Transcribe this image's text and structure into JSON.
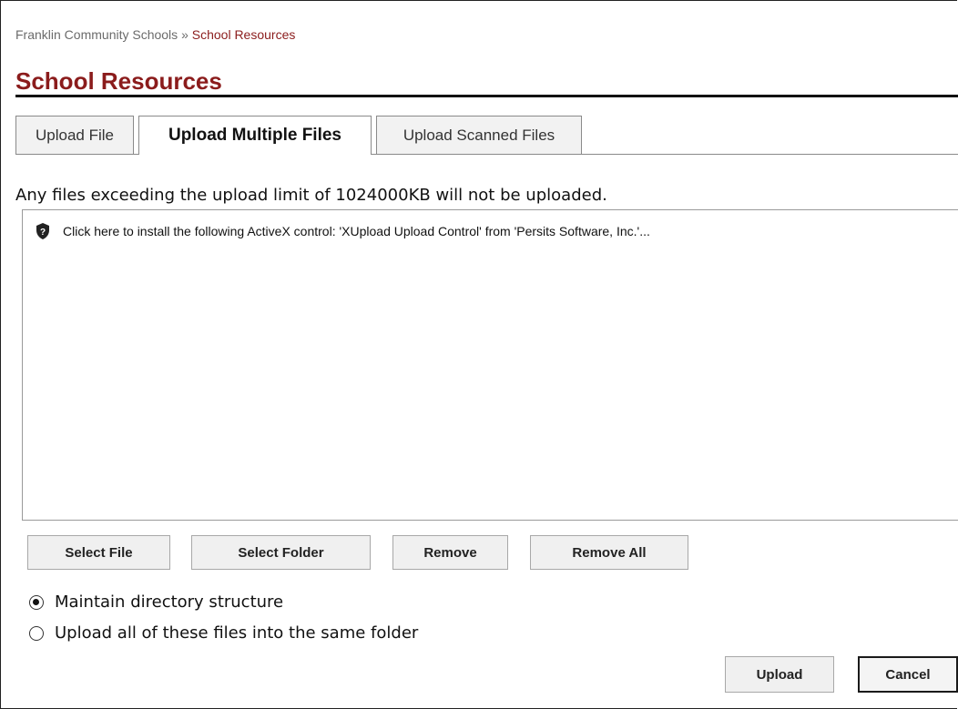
{
  "breadcrumb": {
    "parent": "Franklin Community Schools",
    "separator": "»",
    "current": "School Resources"
  },
  "page_title": "School Resources",
  "tabs": [
    {
      "label": "Upload File",
      "active": false
    },
    {
      "label": "Upload Multiple Files",
      "active": true
    },
    {
      "label": "Upload Scanned Files",
      "active": false
    }
  ],
  "upload_limit_text": "Any files exceeding the upload limit of 1024000KB will not be uploaded.",
  "file_list": {
    "activex_message": "Click here to install the following ActiveX control: 'XUpload Upload Control' from 'Persits Software, Inc.'...",
    "activex_icon": "shield-icon"
  },
  "file_buttons": {
    "select_file": "Select File",
    "select_folder": "Select Folder",
    "remove": "Remove",
    "remove_all": "Remove All"
  },
  "options": [
    {
      "label": "Maintain directory structure",
      "checked": true
    },
    {
      "label": "Upload all of these files into the same folder",
      "checked": false
    }
  ],
  "actions": {
    "upload": "Upload",
    "cancel": "Cancel"
  },
  "colors": {
    "brand": "#8b1c1c",
    "text": "#111111",
    "muted": "#6b6b6b"
  }
}
